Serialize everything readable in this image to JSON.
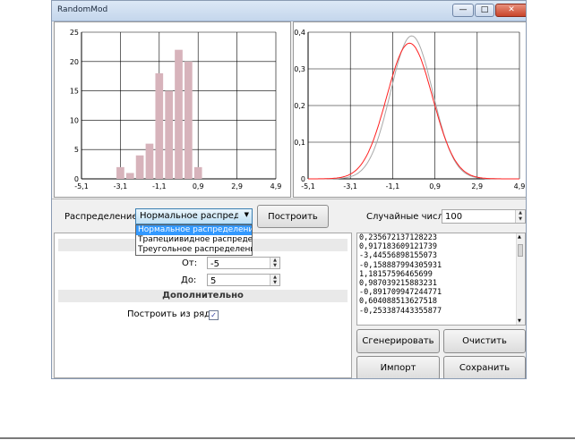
{
  "window": {
    "title": "RandomMod"
  },
  "titlebar": {
    "min_glyph": "—",
    "max_glyph": "□",
    "close_glyph": "✕"
  },
  "chart_data": [
    {
      "type": "bar",
      "x": [
        -3.1,
        -2.6,
        -2.1,
        -1.6,
        -1.1,
        -0.6,
        -0.1,
        0.4,
        0.9
      ],
      "values": [
        2,
        1,
        4,
        6,
        18,
        15,
        22,
        20,
        2
      ],
      "xticks": [
        "-5,1",
        "-3,1",
        "-1,1",
        "0,9",
        "2,9",
        "4,9"
      ],
      "yticks": [
        "0",
        "5",
        "10",
        "15",
        "20",
        "25"
      ],
      "xlim": [
        -5.1,
        4.9
      ],
      "ylim": [
        0,
        25
      ],
      "grid": true,
      "bar_color": "#d7b3bb"
    },
    {
      "type": "line",
      "xticks": [
        "-5,1",
        "-3,1",
        "-1,1",
        "0,9",
        "2,9",
        "4,9"
      ],
      "yticks": [
        "0",
        "0,1",
        "0,2",
        "0,3",
        "0,4"
      ],
      "xlim": [
        -5.1,
        4.9
      ],
      "ylim": [
        0,
        0.4
      ],
      "grid": true,
      "series": [
        {
          "mean": -0.2,
          "sd": 1.0,
          "peak": 0.39,
          "color": "#a8a8a8"
        },
        {
          "mean": -0.3,
          "sd": 1.08,
          "peak": 0.37,
          "color": "#ff2020"
        }
      ]
    }
  ],
  "controls": {
    "distribution_label": "Распределение:",
    "distribution_value": "Нормальное распределение",
    "combo_arrow": "▼",
    "build_button": "Построить",
    "random_numbers_label": "Случайные числа:",
    "random_numbers_value": "100",
    "from_label": "От:",
    "from_value": "-5",
    "to_label": "До:",
    "to_value": "5",
    "additional_header": "Дополнительно",
    "build_from_series_label": "Построить из ряда:",
    "build_from_series_checked": "✓",
    "spin_up": "▲",
    "spin_down": "▼"
  },
  "dropdown": {
    "options": [
      "Нормальное распределение",
      "Трапециивидное распределение",
      "Треугольное распределение"
    ]
  },
  "numbers": [
    "0,235672137128223",
    "0,917183609121739",
    "-3,44556898155073",
    "-0,158887994305931",
    "1,18157596465699",
    "0,987039215883231",
    "-0,891709947244771",
    "0,604088513627518",
    "-0,253387443355877"
  ],
  "buttons": {
    "generate": "Сгенерировать",
    "clear": "Очистить",
    "import": "Импорт",
    "save": "Сохранить"
  }
}
